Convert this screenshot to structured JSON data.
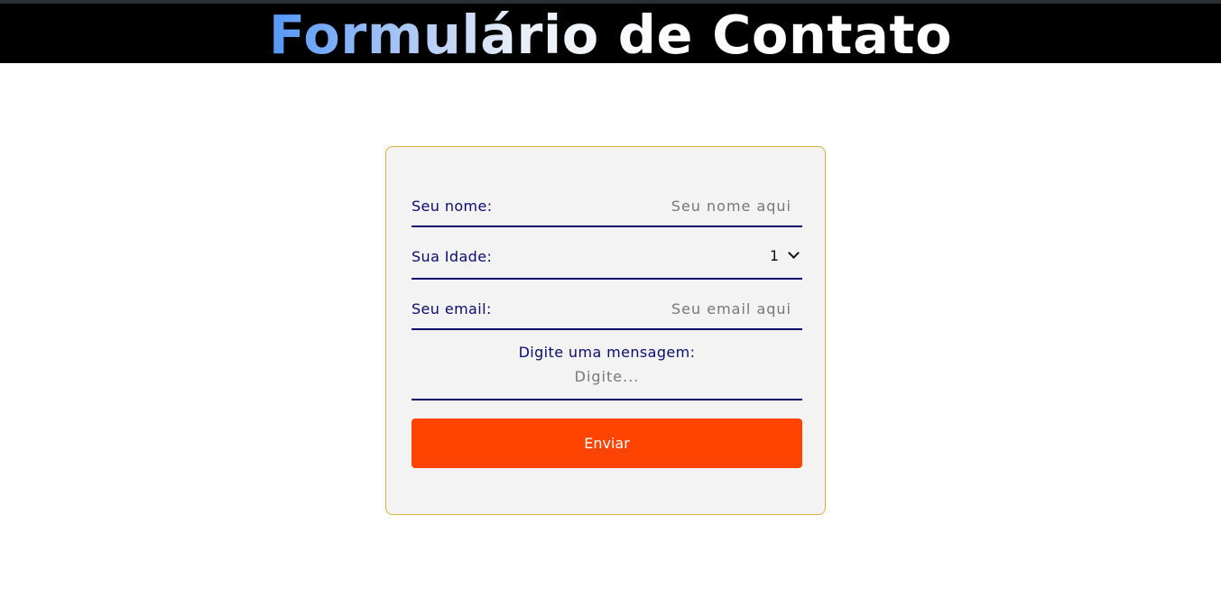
{
  "header": {
    "title": "Formulário de Contato"
  },
  "form": {
    "name": {
      "label": "Seu nome:",
      "placeholder": "Seu nome aqui",
      "value": ""
    },
    "age": {
      "label": "Sua Idade:",
      "selected": "1"
    },
    "email": {
      "label": "Seu email:",
      "placeholder": "Seu email aqui",
      "value": ""
    },
    "message": {
      "label": "Digite uma mensagem:",
      "placeholder": "Digite..."
    },
    "submit_label": "Enviar"
  },
  "colors": {
    "header_bg": "#000000",
    "card_bg": "#f3f3f3",
    "card_border": "#d4b23c",
    "label_text": "#0b0b6e",
    "underline": "#0b0b6e",
    "button_bg": "#ff4300",
    "button_text": "#ffffff",
    "title_gradient_start": "#3d86f5",
    "title_gradient_end": "#ffffff"
  }
}
